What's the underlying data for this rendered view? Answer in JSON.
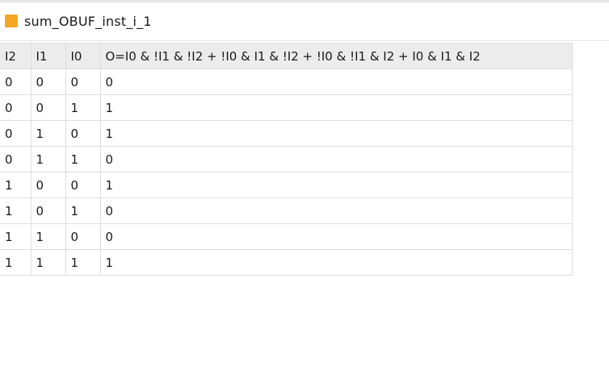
{
  "panel": {
    "title": "sum_OBUF_inst_i_1",
    "icon": "cell-icon",
    "icon_color": "#f5a623"
  },
  "truth_table": {
    "columns": [
      "I2",
      "I1",
      "I0",
      "O=I0 & !I1 & !I2 + !I0 & I1 & !I2 + !I0 & !I1 & I2 + I0 & I1 & I2"
    ],
    "rows": [
      [
        "0",
        "0",
        "0",
        "0"
      ],
      [
        "0",
        "0",
        "1",
        "1"
      ],
      [
        "0",
        "1",
        "0",
        "1"
      ],
      [
        "0",
        "1",
        "1",
        "0"
      ],
      [
        "1",
        "0",
        "0",
        "1"
      ],
      [
        "1",
        "0",
        "1",
        "0"
      ],
      [
        "1",
        "1",
        "0",
        "0"
      ],
      [
        "1",
        "1",
        "1",
        "1"
      ]
    ]
  }
}
